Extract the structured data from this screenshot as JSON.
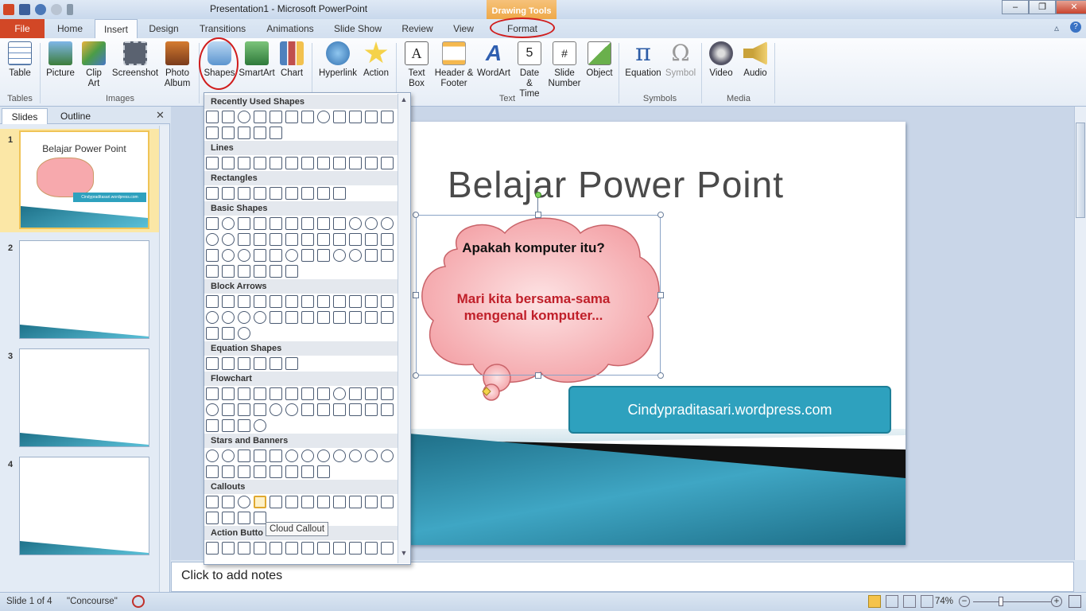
{
  "window": {
    "title": "Presentation1 - Microsoft PowerPoint",
    "context_tab_group": "Drawing Tools",
    "controls": [
      "–",
      "❐",
      "✕"
    ]
  },
  "tabs": {
    "file": "File",
    "items": [
      "Home",
      "Insert",
      "Design",
      "Transitions",
      "Animations",
      "Slide Show",
      "Review",
      "View"
    ],
    "format": "Format"
  },
  "ribbon": {
    "buttons": {
      "table": "Table",
      "picture": "Picture",
      "clip_art": "Clip Art",
      "screenshot": "Screenshot",
      "photo_album": "Photo Album",
      "shapes": "Shapes",
      "smartart": "SmartArt",
      "chart": "Chart",
      "hyperlink": "Hyperlink",
      "action": "Action",
      "text_box": "Text Box",
      "header_footer": "Header & Footer",
      "wordart": "WordArt",
      "date_time": "Date & Time",
      "slide_number": "Slide Number",
      "object": "Object",
      "equation": "Equation",
      "symbol": "Symbol",
      "video": "Video",
      "audio": "Audio"
    },
    "groups": {
      "tables": "Tables",
      "images": "Images",
      "text": "Text",
      "symbols": "Symbols",
      "media": "Media"
    }
  },
  "pane": {
    "tabs": [
      "Slides",
      "Outline"
    ],
    "slide_numbers": [
      "1",
      "2",
      "3",
      "4"
    ]
  },
  "thumbnail1": {
    "title": "Belajar Power Point",
    "banner": "Cindypraditasari.wordpress.com"
  },
  "gallery": {
    "sections": [
      "Recently Used Shapes",
      "Lines",
      "Rectangles",
      "Basic Shapes",
      "Block Arrows",
      "Equation Shapes",
      "Flowchart",
      "Stars and Banners",
      "Callouts",
      "Action Butto"
    ],
    "tooltip": "Cloud Callout"
  },
  "slide": {
    "title": "Belajar Power Point",
    "cloud_line1": "Apakah komputer itu?",
    "cloud_line2": "Mari kita bersama-sama mengenal komputer...",
    "banner": "Cindypraditasari.wordpress.com"
  },
  "notes": {
    "placeholder": "Click to add notes"
  },
  "status": {
    "slide": "Slide 1 of 4",
    "theme": "\"Concourse\"",
    "zoom": "74%"
  },
  "colors": {
    "file_tab": "#d24726",
    "accent_red": "#d01c1c",
    "band_blue": "#2ea1be",
    "cloud_fill": "#f7a9ad"
  }
}
